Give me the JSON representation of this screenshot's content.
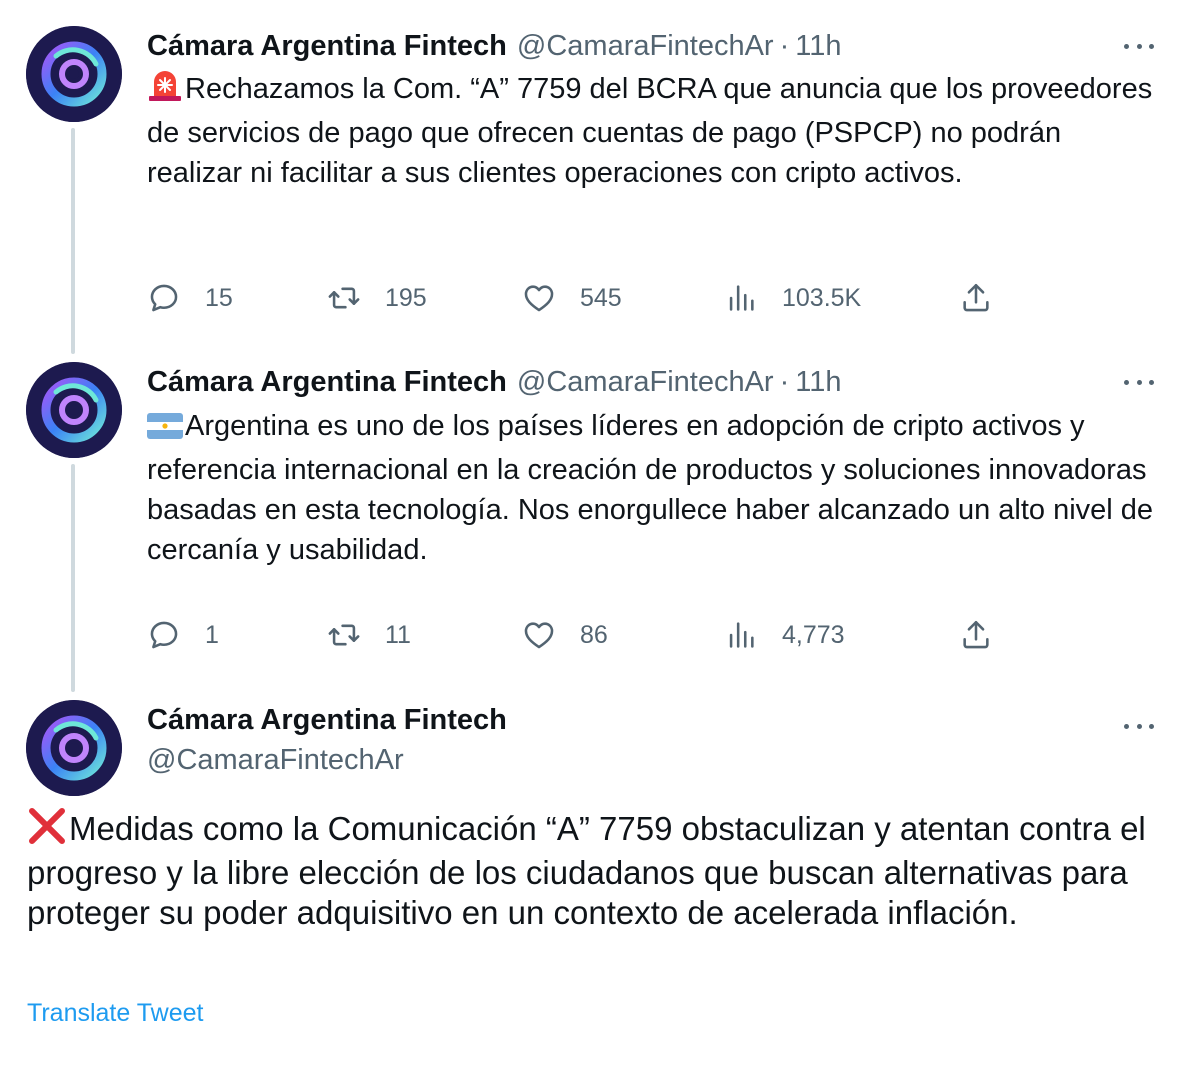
{
  "tweets": [
    {
      "name": "Cámara Argentina Fintech",
      "handle": "@CamaraFintechAr",
      "separator": "·",
      "time": "11h",
      "emoji": "rotating-light",
      "text": "Rechazamos  la Com. “A” 7759 del BCRA que anuncia que los proveedores de servicios de pago que ofrecen cuentas de pago (PSPCP) no podrán realizar ni facilitar a sus clientes operaciones con cripto activos.",
      "replies": "15",
      "retweets": "195",
      "likes": "545",
      "views": "103.5K"
    },
    {
      "name": "Cámara Argentina Fintech",
      "handle": "@CamaraFintechAr",
      "separator": "·",
      "time": "11h",
      "emoji": "argentina-flag",
      "text": "Argentina es uno de los países líderes en adopción de cripto activos y referencia internacional en la creación de productos y soluciones innovadoras basadas en esta tecnología. Nos enorgullece haber alcanzado un alto nivel de cercanía y usabilidad.",
      "replies": "1",
      "retweets": "11",
      "likes": "86",
      "views": "4,773"
    }
  ],
  "main_tweet": {
    "name": "Cámara Argentina Fintech",
    "handle": "@CamaraFintechAr",
    "emoji": "cross-mark",
    "text": "Medidas como la Comunicación “A” 7759 obstaculizan y atentan contra el progreso y la libre elección de los ciudadanos que buscan alternativas para proteger su poder adquisitivo en un contexto de acelerada inflación.",
    "translate_label": "Translate Tweet"
  },
  "icons": {
    "reply": "reply-icon",
    "retweet": "retweet-icon",
    "like": "like-icon",
    "views": "views-icon",
    "share": "share-icon",
    "more": "more-icon"
  },
  "colors": {
    "text": "#0f1419",
    "secondary": "#536471",
    "link": "#1d9bf0",
    "thread_line": "#cfd9de",
    "avatar_bg": "#1d1a4f"
  }
}
